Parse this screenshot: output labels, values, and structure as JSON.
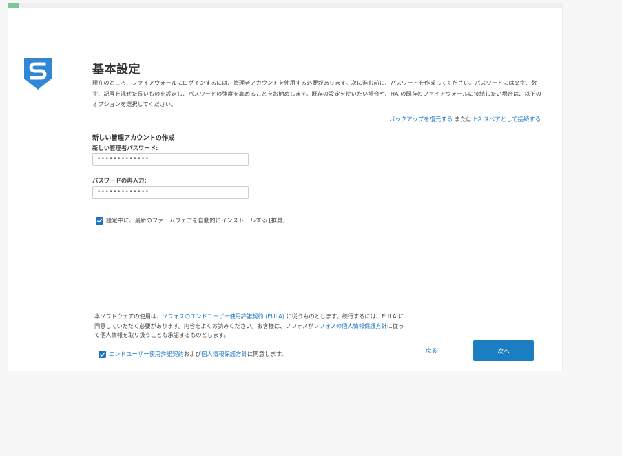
{
  "colors": {
    "accent": "#1a76c5",
    "logo": "#2f87d5",
    "progress": "#7cc898",
    "button": "#1b7dc2",
    "checkbox": "#1a73c4"
  },
  "progress": {
    "value_percent": 2
  },
  "logo": {
    "icon": "sophos-shield-s-logo"
  },
  "title": "基本設定",
  "intro": {
    "text": "現在のところ、ファイアウォールにログインするには、管理者アカウントを使用する必要があります。次に進む前に、パスワードを作成してください。パスワードには文字、数字、記号を混ぜた長いものを設定し、パスワードの強度を高めることをお勧めします。既存の設定を使いたい場合や、HA の既存のファイアウォールに接続したい場合は、以下のオプションを選択してください。"
  },
  "restore": {
    "backup_link": "バックアップを復元する",
    "or_text": " または ",
    "ha_link": "HA スペアとして接続する"
  },
  "account": {
    "heading": "新しい管理アカウントの作成",
    "password_label": "新しい管理者パスワード:",
    "password_value": "•••••••••••••",
    "reenter_label": "パスワードの再入力:",
    "reenter_value": "•••••••••••••"
  },
  "firmware": {
    "checked": true,
    "label": "設定中に、最新のファームウェアを自動的にインストールする [推奨]"
  },
  "eula": {
    "part1": "本ソフトウェアの使用は、",
    "link1": "ソフォスのエンドユーザー使用許諾契約 (EULA)",
    "part2": " に従うものとします。続行するには、EULA に同意していただく必要があります。内容をよくお読みください。お客様は、ソフォスが",
    "link2": "ソフォスの個人情報保護方針",
    "part3": "に従って個人情報を取り扱うことも承認するものとします。"
  },
  "agree": {
    "checked": true,
    "link1": "エンドユーザー使用許諾契約",
    "and_text": "および",
    "link2": "個人情報保護方針",
    "suffix": "に同意します。"
  },
  "nav": {
    "back_label": "戻る",
    "next_label": "次へ"
  }
}
